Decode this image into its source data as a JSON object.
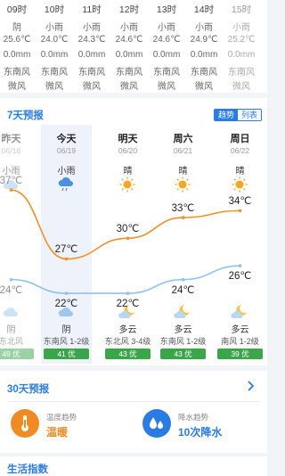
{
  "hourly": [
    {
      "time": "09时",
      "cond": "阴",
      "temp": "25.6℃",
      "rain": "0.0mm",
      "wind_dir": "东南风",
      "wind_level": "微风"
    },
    {
      "time": "10时",
      "cond": "小雨",
      "temp": "24.0℃",
      "rain": "0.0mm",
      "wind_dir": "东南风",
      "wind_level": "微风"
    },
    {
      "time": "11时",
      "cond": "小雨",
      "temp": "24.3℃",
      "rain": "0.0mm",
      "wind_dir": "东南风",
      "wind_level": "微风"
    },
    {
      "time": "12时",
      "cond": "小雨",
      "temp": "24.6℃",
      "rain": "0.0mm",
      "wind_dir": "东南风",
      "wind_level": "微风"
    },
    {
      "time": "13时",
      "cond": "小雨",
      "temp": "24.6℃",
      "rain": "0.0mm",
      "wind_dir": "东南风",
      "wind_level": "微风"
    },
    {
      "time": "14时",
      "cond": "小雨",
      "temp": "24.9℃",
      "rain": "0.0mm",
      "wind_dir": "东南风",
      "wind_level": "微风"
    },
    {
      "time": "15时",
      "cond": "小雨",
      "temp": "25.2℃",
      "rain": "0.0mm",
      "wind_dir": "东南风",
      "wind_level": "微风"
    }
  ],
  "seven_day": {
    "title": "7天预报",
    "toggle_trend": "趋势",
    "toggle_list": "列表",
    "days": [
      {
        "name": "昨天",
        "date": "06/18",
        "day_cond": "小雨",
        "day_icon": "cloud-icon",
        "high": "37℃",
        "low": "24℃",
        "night_cond": "阴",
        "night_icon": "cloud-icon",
        "wind": "东北风",
        "aqi": "49 优"
      },
      {
        "name": "今天",
        "date": "06/19",
        "day_cond": "小雨",
        "day_icon": "rain-icon",
        "high": "27℃",
        "low": "22℃",
        "night_cond": "阴",
        "night_icon": "cloud-icon",
        "wind": "东南风 1-2级",
        "aqi": "41 优"
      },
      {
        "name": "明天",
        "date": "06/20",
        "day_cond": "晴",
        "day_icon": "sun-icon",
        "high": "30℃",
        "low": "22℃",
        "night_cond": "多云",
        "night_icon": "moon-cloud-icon",
        "wind": "东北风 3-4级",
        "aqi": "43 优"
      },
      {
        "name": "周六",
        "date": "06/21",
        "day_cond": "晴",
        "day_icon": "sun-icon",
        "high": "33℃",
        "low": "24℃",
        "night_cond": "多云",
        "night_icon": "moon-cloud-icon",
        "wind": "东南风 1-2级",
        "aqi": "43 优"
      },
      {
        "name": "周日",
        "date": "06/22",
        "day_cond": "晴",
        "day_icon": "sun-icon",
        "high": "34℃",
        "low": "26℃",
        "night_cond": "多云",
        "night_icon": "moon-cloud-icon",
        "wind": "南风 1-2级",
        "aqi": "39 优"
      }
    ]
  },
  "chart_data": {
    "type": "line",
    "categories": [
      "昨天",
      "今天",
      "明天",
      "周六",
      "周日"
    ],
    "series": [
      {
        "values": [
          37,
          27,
          30,
          33,
          34
        ],
        "color": "#f0912a"
      },
      {
        "values": [
          24,
          22,
          22,
          24,
          26
        ],
        "color": "#8fc3ea"
      }
    ],
    "ylim": [
      18,
      40
    ]
  },
  "thirty_day": {
    "title": "30天预报",
    "temp_trend_label": "温度趋势",
    "temp_trend_value": "温暖",
    "temp_color": "#f08a24",
    "rain_trend_label": "降水趋势",
    "rain_trend_value": "10次降水",
    "rain_color": "#2a7be4"
  },
  "life": {
    "title": "生活指数"
  }
}
